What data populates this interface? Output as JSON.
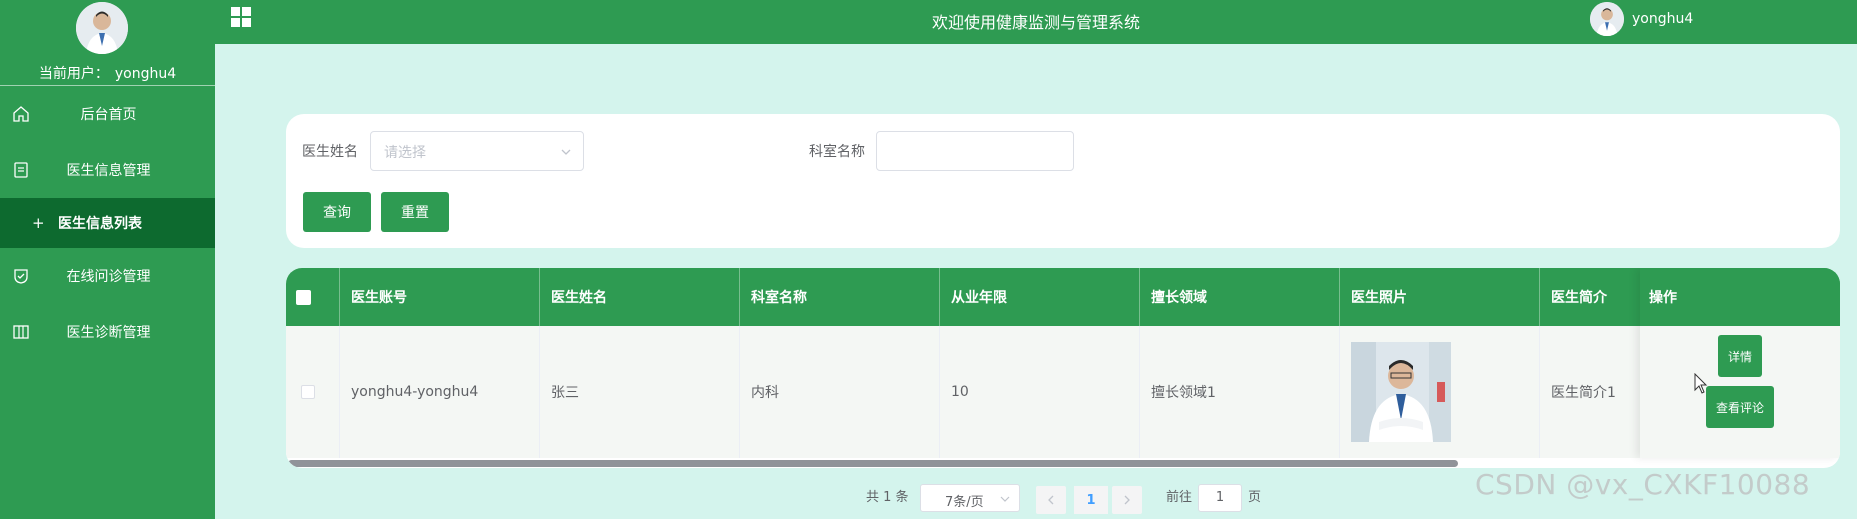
{
  "sidebar": {
    "current_user_label": "当前用户：",
    "current_user": "yonghu4",
    "items": [
      {
        "label": "后台首页",
        "icon": "home-icon"
      },
      {
        "label": "医生信息管理",
        "icon": "document-icon"
      },
      {
        "label": "在线问诊管理",
        "icon": "shield-check-icon"
      },
      {
        "label": "医生诊断管理",
        "icon": "columns-icon"
      }
    ],
    "submenu": {
      "prefix": "+",
      "label": "医生信息列表"
    }
  },
  "header": {
    "title": "欢迎使用健康监测与管理系统",
    "username": "yonghu4"
  },
  "search": {
    "doctor_name_label": "医生姓名",
    "doctor_name_placeholder": "请选择",
    "department_label": "科室名称",
    "department_value": "",
    "query_button": "查询",
    "reset_button": "重置"
  },
  "table": {
    "columns": [
      "医生账号",
      "医生姓名",
      "科室名称",
      "从业年限",
      "擅长领域",
      "医生照片",
      "医生简介",
      "操作"
    ],
    "rows": [
      {
        "account": "yonghu4-yonghu4",
        "name": "张三",
        "department": "内科",
        "years": "10",
        "specialty": "擅长领域1",
        "intro": "医生简介1"
      }
    ],
    "actions": {
      "detail": "详情",
      "view_comments": "查看评论"
    }
  },
  "pagination": {
    "total_text": "共 1 条",
    "page_size": "7条/页",
    "current_page": "1",
    "goto_label": "前往",
    "goto_value": "1",
    "page_suffix": "页"
  },
  "watermark": "CSDN @vx_CXKF10088",
  "colors": {
    "primary": "#2e9b52",
    "submenu_active": "#0d6a2f",
    "background": "#d4f4ed",
    "pager_active": "#409eff"
  }
}
